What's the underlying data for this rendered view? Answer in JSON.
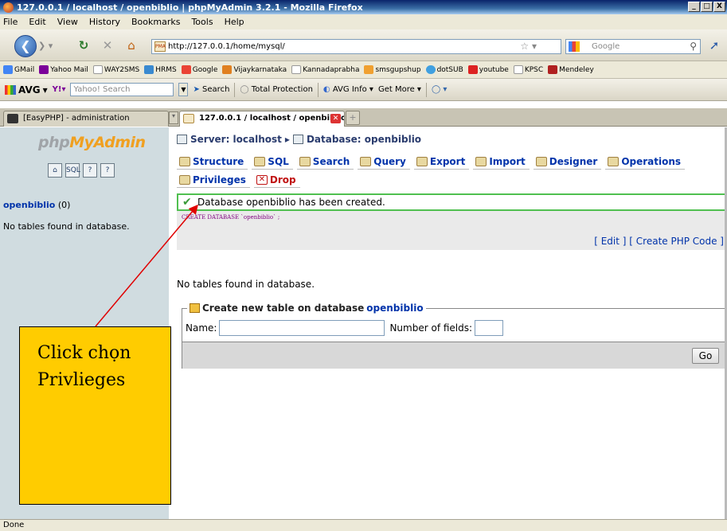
{
  "window": {
    "title": "127.0.0.1 / localhost / openbiblio | phpMyAdmin 3.2.1 - Mozilla Firefox",
    "controls": [
      "_",
      "□",
      "X"
    ]
  },
  "menu": [
    "File",
    "Edit",
    "View",
    "History",
    "Bookmarks",
    "Tools",
    "Help"
  ],
  "nav": {
    "url": "http://127.0.0.1/home/mysql/",
    "url_icon": "PMA",
    "search_placeholder": "Google"
  },
  "bookmarks": [
    "GMail",
    "Yahoo Mail",
    "WAY2SMS",
    "HRMS",
    "Google",
    "Vijaykarnataka",
    "Kannadaprabha",
    "smsgupshup",
    "dotSUB",
    "youtube",
    "KPSC",
    "Mendeley"
  ],
  "avg_toolbar": {
    "brand": "AVG",
    "yahoo_placeholder": "Yahoo! Search",
    "items": [
      "Search",
      "Total Protection",
      "AVG Info",
      "Get More"
    ]
  },
  "tabs": [
    {
      "title": "[EasyPHP] - administration"
    },
    {
      "title": "127.0.0.1 / localhost / openbiblio ..."
    }
  ],
  "sidebar": {
    "logo_a": "php",
    "logo_b": "MyAdmin",
    "db_name": "openbiblio",
    "db_count": "(0)",
    "note": "No tables found in database."
  },
  "main": {
    "crumb_server": "Server: localhost",
    "crumb_db": "Database: openbiblio",
    "tabs": [
      "Structure",
      "SQL",
      "Search",
      "Query",
      "Export",
      "Import",
      "Designer",
      "Operations",
      "Privileges",
      "Drop"
    ],
    "success_msg": "Database openbiblio has been created.",
    "sql": "CREATE DATABASE `openbiblio` ;",
    "edit_link": "[ Edit ]",
    "php_link": "[ Create PHP Code ]",
    "no_tables": "No tables found in database.",
    "create_legend": "Create new table on database",
    "create_db": "openbiblio",
    "name_label": "Name:",
    "fields_label": "Number of fields:",
    "go": "Go"
  },
  "status": "Done",
  "callout": {
    "line1": "Click chọn",
    "line2": "Privlieges"
  }
}
